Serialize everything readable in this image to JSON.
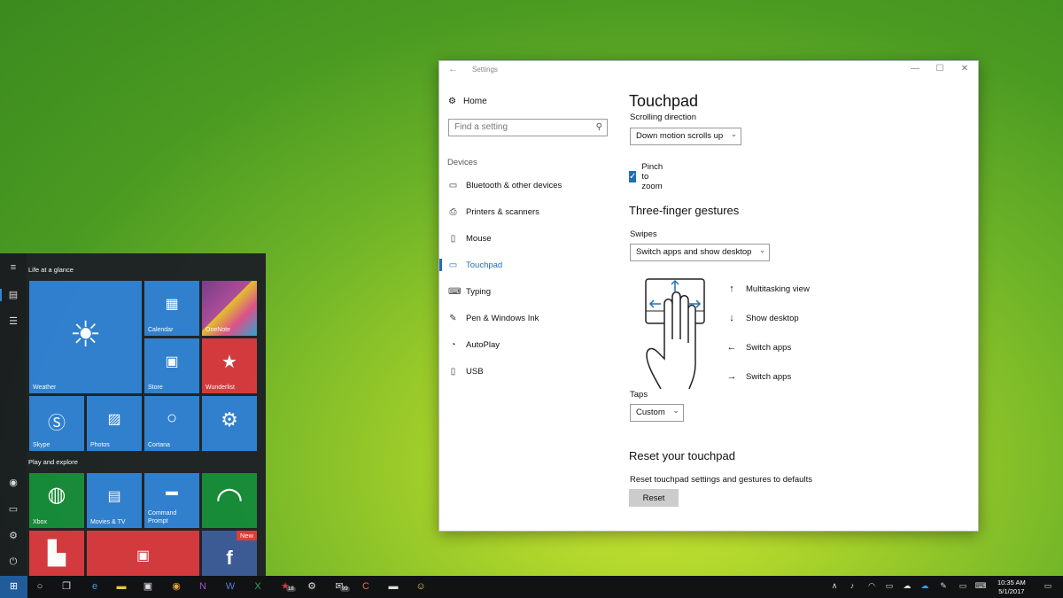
{
  "window": {
    "back": "←",
    "title": "Settings",
    "minimize": "—",
    "maximize": "☐",
    "close": "✕"
  },
  "nav": {
    "home": "Home",
    "search_placeholder": "Find a setting",
    "section": "Devices",
    "items": [
      {
        "label": "Bluetooth & other devices",
        "icon": "bluetooth-devices-icon"
      },
      {
        "label": "Printers & scanners",
        "icon": "printer-icon"
      },
      {
        "label": "Mouse",
        "icon": "mouse-icon"
      },
      {
        "label": "Touchpad",
        "icon": "touchpad-icon",
        "active": true
      },
      {
        "label": "Typing",
        "icon": "keyboard-icon"
      },
      {
        "label": "Pen & Windows Ink",
        "icon": "pen-icon"
      },
      {
        "label": "AutoPlay",
        "icon": "autoplay-icon"
      },
      {
        "label": "USB",
        "icon": "usb-icon"
      }
    ]
  },
  "touchpad": {
    "title": "Touchpad",
    "scrolling_label": "Scrolling direction",
    "scrolling_value": "Down motion scrolls up",
    "pinch_label": "Pinch to zoom",
    "pinch_checked": true,
    "three_finger_heading": "Three-finger gestures",
    "swipes_label": "Swipes",
    "swipes_value": "Switch apps and show desktop",
    "gestures": [
      {
        "arrow": "↑",
        "label": "Multitasking view"
      },
      {
        "arrow": "↓",
        "label": "Show desktop"
      },
      {
        "arrow": "←",
        "label": "Switch apps"
      },
      {
        "arrow": "→",
        "label": "Switch apps"
      }
    ],
    "taps_label": "Taps",
    "taps_value": "Custom",
    "reset_heading": "Reset your touchpad",
    "reset_text": "Reset touchpad settings and gestures to defaults",
    "reset_button": "Reset"
  },
  "start_menu": {
    "group1": "Life at a glance",
    "group2": "Play and explore",
    "tiles": {
      "weather": "Weather",
      "calendar": "Calendar",
      "onenote": "OneNote",
      "store": "Store",
      "wunderlist": "Wunderlist",
      "skype": "Skype",
      "photos": "Photos",
      "cortana": "Cortana",
      "xbox": "Xbox",
      "movies": "Movies & TV",
      "command_prompt": "Command Prompt",
      "new_badge": "New"
    }
  },
  "taskbar": {
    "badge_1": "18",
    "badge_2": "99",
    "time": "10:35 AM",
    "date": "5/1/2017"
  },
  "colors": {
    "accent": "#1e6fb8",
    "start_bg": "#1e2126",
    "tile_blue": "#2f7fd4",
    "tile_green": "#168a3a",
    "tile_red": "#d7373f"
  }
}
